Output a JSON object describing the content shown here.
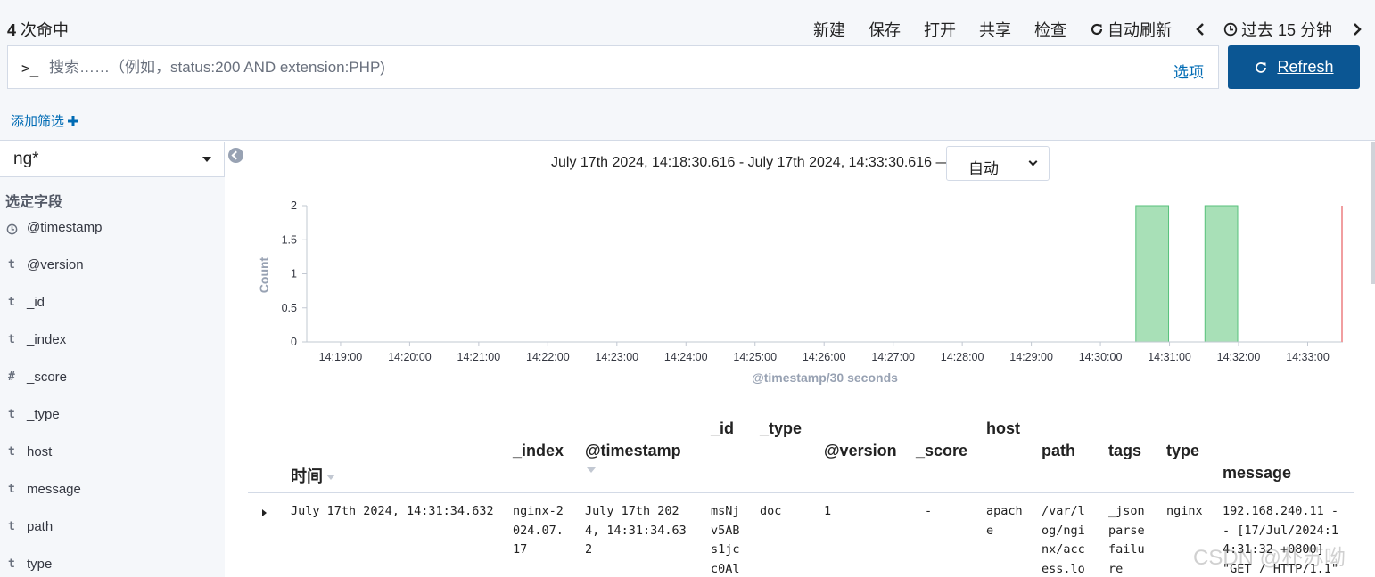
{
  "header": {
    "hits_count": "4",
    "hits_label": "次命中",
    "menu": {
      "new": "新建",
      "save": "保存",
      "open": "打开",
      "share": "共享",
      "inspect": "检查",
      "auto_refresh": "自动刷新",
      "time_range": "过去 15 分钟"
    }
  },
  "query": {
    "prompt": ">_",
    "placeholder": "搜索……（例如，status:200 AND extension:PHP)",
    "options_label": "选项",
    "refresh_label": "Refresh"
  },
  "filter": {
    "add_label": "添加筛选"
  },
  "sidebar": {
    "index_pattern": "ng*",
    "selected_fields_title": "选定字段",
    "fields": [
      {
        "type_glyph": "clock",
        "name": "@timestamp"
      },
      {
        "type_glyph": "t",
        "name": "@version"
      },
      {
        "type_glyph": "t",
        "name": "_id"
      },
      {
        "type_glyph": "t",
        "name": "_index"
      },
      {
        "type_glyph": "#",
        "name": "_score"
      },
      {
        "type_glyph": "t",
        "name": "_type"
      },
      {
        "type_glyph": "t",
        "name": "host"
      },
      {
        "type_glyph": "t",
        "name": "message"
      },
      {
        "type_glyph": "t",
        "name": "path"
      },
      {
        "type_glyph": "t",
        "name": "type"
      }
    ]
  },
  "histogram": {
    "time_range_text": "July 17th 2024, 14:18:30.616 - July 17th 2024, 14:33:30.616 —",
    "interval": "自动"
  },
  "chart_data": {
    "type": "bar",
    "ylabel": "Count",
    "xlabel": "@timestamp/30 seconds",
    "ylim": [
      0,
      2
    ],
    "y_ticks": [
      "0",
      "0.5",
      "1",
      "1.5",
      "2"
    ],
    "x_tick_labels": [
      "14:19:00",
      "14:20:00",
      "14:21:00",
      "14:22:00",
      "14:23:00",
      "14:24:00",
      "14:25:00",
      "14:26:00",
      "14:27:00",
      "14:28:00",
      "14:29:00",
      "14:30:00",
      "14:31:00",
      "14:32:00",
      "14:33:00"
    ],
    "x": [
      "14:30:30",
      "14:31:30"
    ],
    "values": [
      2,
      2
    ],
    "bar_color": "#a8e0b7",
    "bar_border": "#57c17b",
    "now_marker_color": "#f19ea0",
    "grid": false
  },
  "table": {
    "columns": [
      "时间",
      "_index",
      "@timestamp",
      "_id",
      "_type",
      "@version",
      "_score",
      "host",
      "path",
      "tags",
      "type",
      "message"
    ],
    "row": {
      "time": "July 17th 2024, 14:31:34.632",
      "index": "nginx-2\n024.07.\n17",
      "timestamp": "July 17th 202\n4, 14:31:34.63\n2",
      "id": "msNj\nv5AB\ns1jc\nc0Al",
      "type_": "doc",
      "version": "1",
      "score": "-",
      "host": "apach\ne",
      "path": "/var/l\nog/ngi\nnx/acc\ness.lo",
      "tags": "_json\nparse\nfailu\nre",
      "type": "nginx",
      "message": "192.168.240.11 -\n- [17/Jul/2024:1\n4:31:32 +0800]\n\"GET / HTTP/1.1\""
    }
  },
  "watermark": "CSDN @朴苏呦"
}
